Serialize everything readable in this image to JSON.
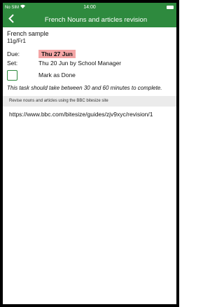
{
  "status_bar": {
    "carrier": "No SIM",
    "wifi_icon": "wifi-icon",
    "time": "14:00",
    "battery_icon": "battery-icon"
  },
  "nav": {
    "back_icon": "chevron-left-icon",
    "title": "French Nouns and articles revision"
  },
  "task": {
    "subject": "French sample",
    "group": "11g/Fr1",
    "due_label": "Due:",
    "due_value": "Thu 27 Jun",
    "set_label": "Set:",
    "set_value": "Thu 20 Jun by  School Manager",
    "done_label": "Mark as Done",
    "duration": "This task should take between 30 and 60 minutes to complete.",
    "description": "Revise nouns and articles using the BBC bitesize site",
    "link": "https://www.bbc.com/bitesize/guides/zjv9xyc/revision/1"
  },
  "colors": {
    "header_green": "#2e8a3e",
    "due_highlight": "#f4a6a6",
    "description_bg": "#ebebeb"
  }
}
